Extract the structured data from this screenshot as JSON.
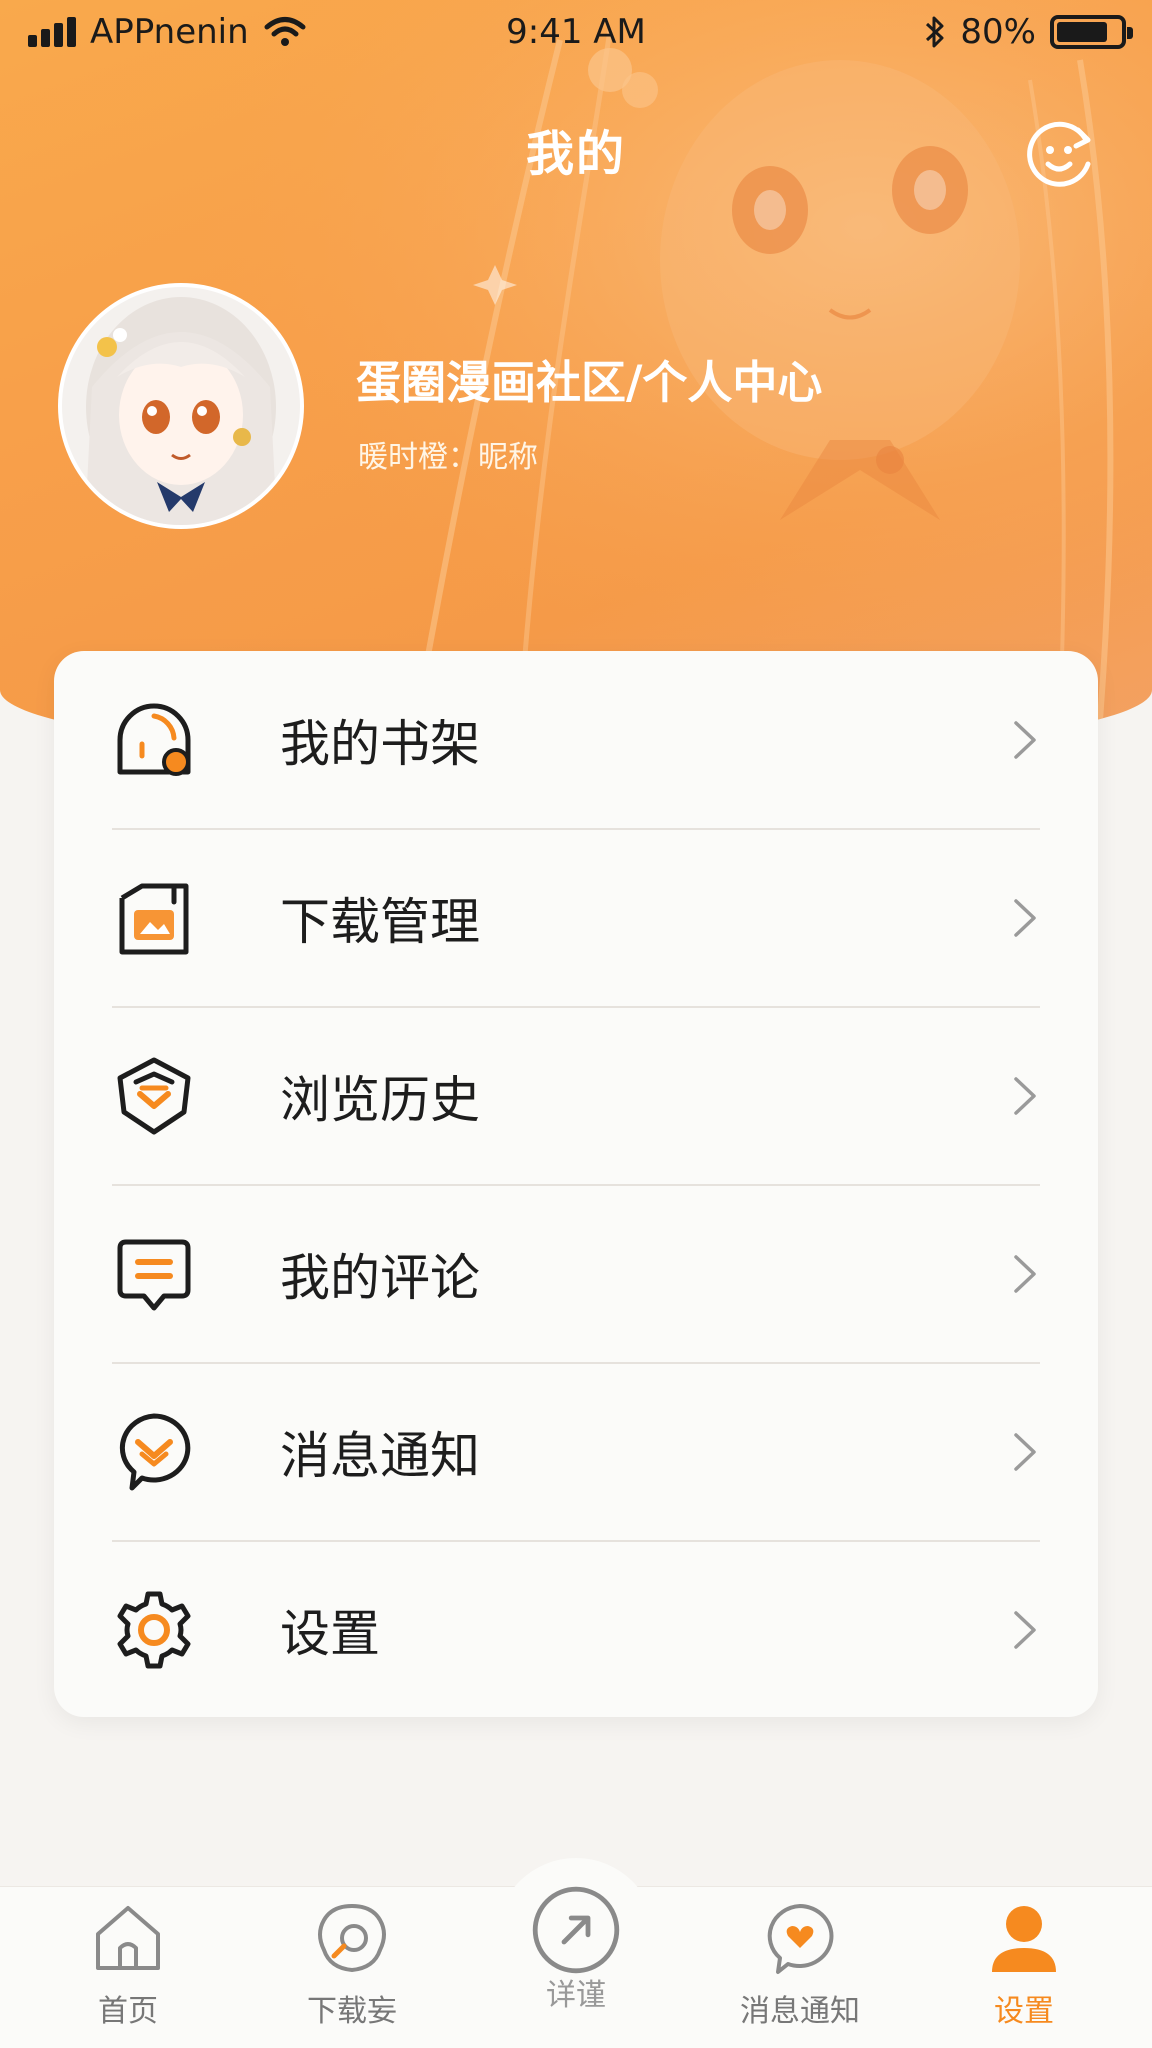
{
  "status_bar": {
    "carrier": "APPnenin",
    "time": "9:41 AM",
    "battery": "80%",
    "battery_level": 0.8
  },
  "header": {
    "title": "我的",
    "refresh_icon": "smile-refresh-icon"
  },
  "profile": {
    "name": "蛋圈漫画社区/个人中心",
    "nickname": "暖时橙：昵称"
  },
  "menu": {
    "items": [
      {
        "label": "我的书架",
        "icon": "bookshelf-icon"
      },
      {
        "label": "下载管理",
        "icon": "download-manager-icon"
      },
      {
        "label": "浏览历史",
        "icon": "history-icon"
      },
      {
        "label": "我的评论",
        "icon": "comment-icon"
      },
      {
        "label": "消息通知",
        "icon": "notification-icon"
      },
      {
        "label": "设置",
        "icon": "gear-icon"
      }
    ]
  },
  "tab_bar": {
    "tabs": [
      {
        "label": "首页",
        "icon": "home-icon"
      },
      {
        "label": "下载妄",
        "icon": "download-icon"
      },
      {
        "label": "详谨",
        "icon": "arrow-up-right-icon"
      },
      {
        "label": "消息通知",
        "icon": "heart-chat-icon"
      },
      {
        "label": "设置",
        "icon": "user-icon",
        "active": true
      }
    ]
  },
  "colors": {
    "accent": "#f68a1f",
    "hero_orange": "#f8a04a",
    "card_bg": "#fbfbf9",
    "text_dark": "#1d1d1d"
  }
}
